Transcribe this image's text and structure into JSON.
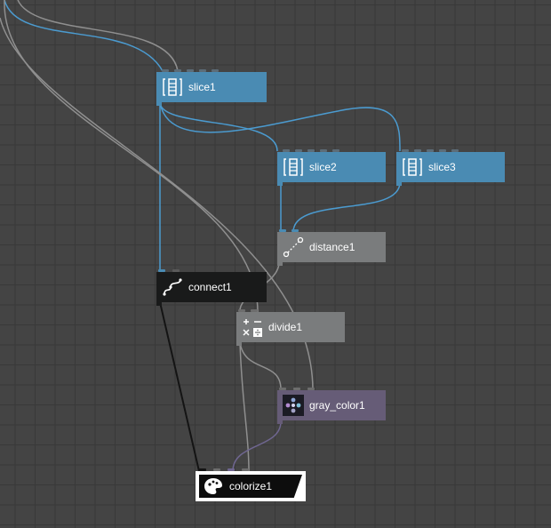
{
  "nodes": {
    "slice1": {
      "label": "slice1",
      "icon": "slice-icon"
    },
    "slice2": {
      "label": "slice2",
      "icon": "slice-icon"
    },
    "slice3": {
      "label": "slice3",
      "icon": "slice-icon"
    },
    "distance1": {
      "label": "distance1",
      "icon": "distance-icon"
    },
    "connect1": {
      "label": "connect1",
      "icon": "connect-icon"
    },
    "divide1": {
      "label": "divide1",
      "icon": "divide-icon"
    },
    "gray_color1": {
      "label": "gray_color1",
      "icon": "color-dots-icon"
    },
    "colorize1": {
      "label": "colorize1",
      "icon": "colorize-icon"
    }
  },
  "colors": {
    "background": "#444444",
    "grid": "#393939",
    "slice_node": "#4a8bb3",
    "gray_node": "#7a7c7d",
    "dark_node": "#191a1a",
    "purple_node": "#665c77",
    "wire_blue": "#4b9bd0",
    "wire_gray": "#8f8f8f",
    "wire_black": "#141414",
    "wire_purple": "#6f6690"
  }
}
